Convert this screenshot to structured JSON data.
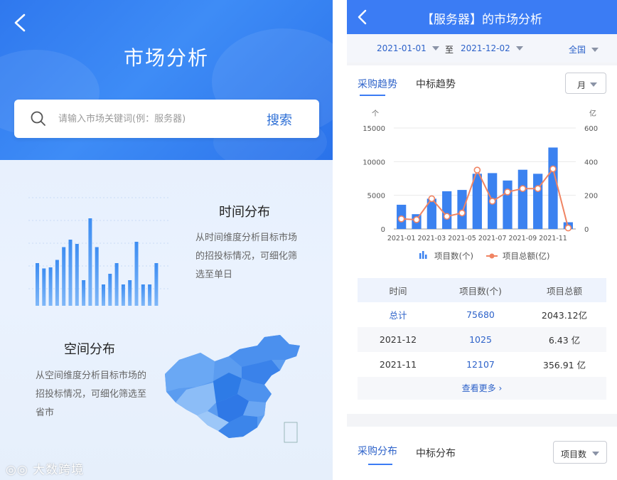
{
  "left": {
    "title": "市场分析",
    "search": {
      "placeholder": "请输入市场关键词(例：服务器)",
      "button": "搜索"
    },
    "time_section": {
      "title": "时间分布",
      "desc": "从时间维度分析目标市场的招投标情况，可细化筛选至单日"
    },
    "space_section": {
      "title": "空间分布",
      "desc": "从空间维度分析目标市场的招投标情况，可细化筛选至省市"
    },
    "watermark": "大数跨境"
  },
  "right": {
    "title": "【服务器】的市场分析",
    "filters": {
      "start_date": "2021-01-01",
      "to": "至",
      "end_date": "2021-12-02",
      "region": "全国"
    },
    "tabs": [
      "采购趋势",
      "中标趋势"
    ],
    "period_select": "月",
    "table": {
      "headers": [
        "时间",
        "项目数(个)",
        "项目总额"
      ],
      "rows": [
        {
          "time": "总计",
          "count": "75680",
          "amount": "2043.12亿"
        },
        {
          "time": "2021-12",
          "count": "1025",
          "amount": "6.43 亿"
        },
        {
          "time": "2021-11",
          "count": "12107",
          "amount": "356.91 亿"
        }
      ],
      "more": "查看更多"
    },
    "dist_tabs": [
      "采购分布",
      "中标分布"
    ],
    "dist_select": "项目数"
  },
  "chart_data": {
    "type": "bar",
    "left_unit": "个",
    "right_unit": "亿",
    "x": [
      "2021-01",
      "2021-02",
      "2021-03",
      "2021-04",
      "2021-05",
      "2021-06",
      "2021-07",
      "2021-08",
      "2021-09",
      "2021-10",
      "2021-11",
      "2021-12"
    ],
    "x_tick_labels": [
      "2021-01",
      "2021-03",
      "2021-05",
      "2021-07",
      "2021-09",
      "2021-11"
    ],
    "series": [
      {
        "name": "项目数(个)",
        "type": "bar",
        "axis": "left",
        "values": [
          3600,
          2200,
          4500,
          5600,
          5800,
          8200,
          8300,
          7200,
          8800,
          8200,
          12100,
          1000
        ]
      },
      {
        "name": "项目总额(亿)",
        "type": "line",
        "axis": "right",
        "values": [
          60,
          55,
          180,
          75,
          95,
          350,
          165,
          220,
          240,
          240,
          357,
          6
        ]
      }
    ],
    "ylim_left": [
      0,
      15000
    ],
    "yticks_left": [
      0,
      5000,
      10000,
      15000
    ],
    "ylim_right": [
      0,
      600
    ],
    "yticks_right": [
      0,
      200,
      400,
      600
    ],
    "colors": {
      "bar": "#3b82f0",
      "line": "#f08463"
    }
  },
  "left_illustration": {
    "bars": [
      0.4,
      0.35,
      0.36,
      0.43,
      0.55,
      0.62,
      0.58,
      0.24,
      0.82,
      0.55,
      0.2,
      0.3,
      0.4,
      0.2,
      0.24,
      0.6,
      0.2,
      0.2,
      0.4
    ]
  }
}
